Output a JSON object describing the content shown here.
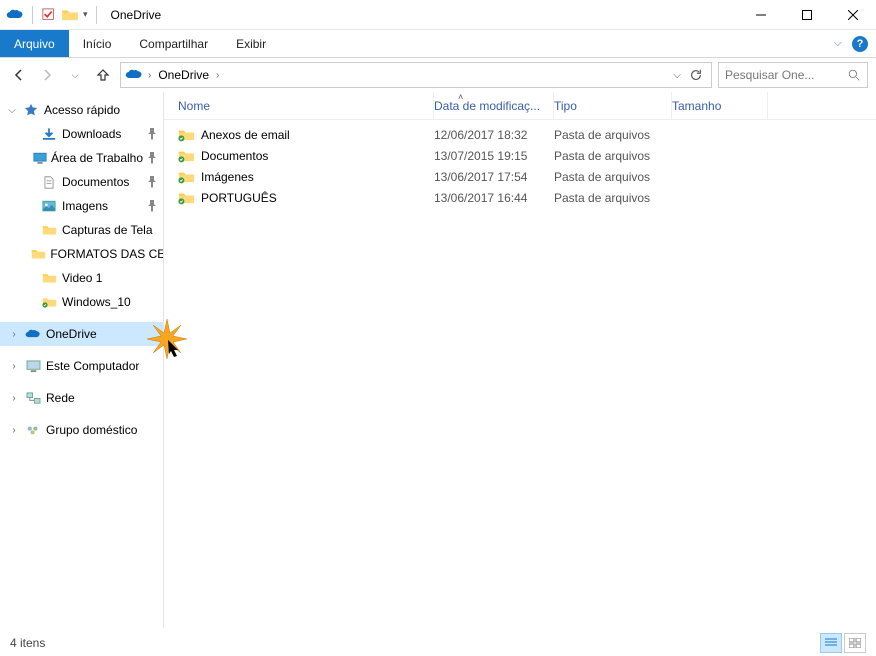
{
  "window": {
    "title": "OneDrive"
  },
  "ribbon": {
    "tabs": {
      "file": "Arquivo",
      "home": "Início",
      "share": "Compartilhar",
      "view": "Exibir"
    }
  },
  "breadcrumb": {
    "segments": [
      "OneDrive"
    ]
  },
  "search": {
    "placeholder": "Pesquisar One..."
  },
  "sidebar": {
    "quick_access": "Acesso rápido",
    "items": [
      {
        "label": "Downloads",
        "pinned": true,
        "icon": "downloads"
      },
      {
        "label": "Área de Trabalho",
        "pinned": true,
        "icon": "desktop"
      },
      {
        "label": "Documentos",
        "pinned": true,
        "icon": "documents"
      },
      {
        "label": "Imagens",
        "pinned": true,
        "icon": "pictures"
      },
      {
        "label": "Capturas de Tela",
        "pinned": false,
        "icon": "folder"
      },
      {
        "label": "FORMATOS DAS CE",
        "pinned": false,
        "icon": "folder"
      },
      {
        "label": "Video 1",
        "pinned": false,
        "icon": "folder"
      },
      {
        "label": "Windows_10",
        "pinned": false,
        "icon": "folder-sync"
      }
    ],
    "onedrive": "OneDrive",
    "this_pc": "Este Computador",
    "network": "Rede",
    "homegroup": "Grupo doméstico"
  },
  "columns": {
    "name": "Nome",
    "modified": "Data de modificaç...",
    "type": "Tipo",
    "size": "Tamanho"
  },
  "files": [
    {
      "name": "Anexos de email",
      "modified": "12/06/2017 18:32",
      "type": "Pasta de arquivos"
    },
    {
      "name": "Documentos",
      "modified": "13/07/2015 19:15",
      "type": "Pasta de arquivos"
    },
    {
      "name": "Imágenes",
      "modified": "13/06/2017 17:54",
      "type": "Pasta de arquivos"
    },
    {
      "name": "PORTUGUÊS",
      "modified": "13/06/2017 16:44",
      "type": "Pasta de arquivos"
    }
  ],
  "status": {
    "count": "4 itens"
  }
}
